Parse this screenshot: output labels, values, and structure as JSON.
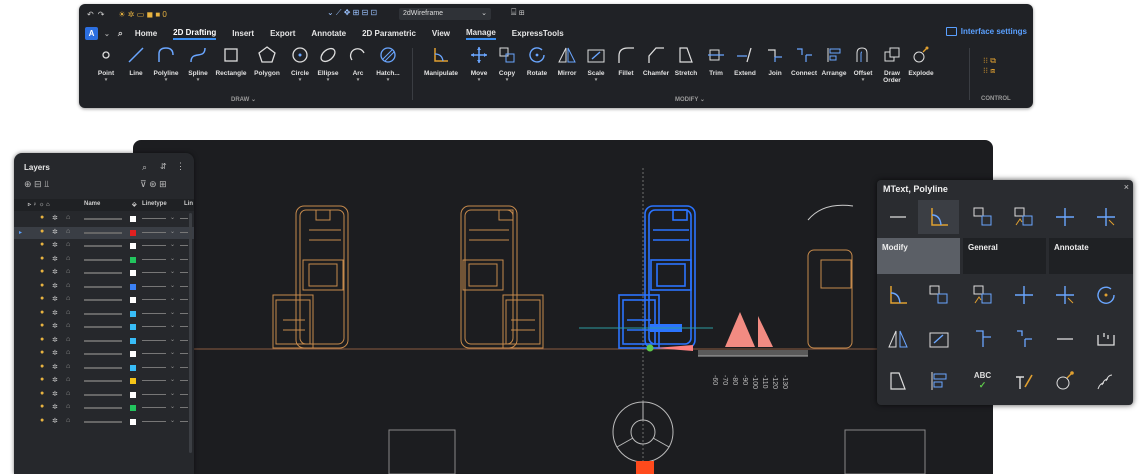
{
  "ribbon": {
    "visual_style": "2dWireframe",
    "interface_settings": "Interface settings",
    "menu_tabs": [
      "Home",
      "2D Drafting",
      "Insert",
      "Export",
      "Annotate",
      "2D Parametric",
      "View",
      "Manage",
      "ExpressTools"
    ],
    "active_tab": "2D Drafting",
    "draw_tools": [
      "Point",
      "Line",
      "Polyline",
      "Spline",
      "Rectangle",
      "Polygon",
      "Circle",
      "Ellipse",
      "Arc",
      "Hatch..."
    ],
    "modify_tools": [
      "Manipulate",
      "Move",
      "Copy",
      "Rotate",
      "Mirror",
      "Scale",
      "Fillet",
      "Chamfer",
      "Stretch",
      "Trim",
      "Extend",
      "Join",
      "Connect",
      "Arrange",
      "Offset",
      "Draw Order",
      "Explode"
    ],
    "groups": {
      "draw": "DRAW",
      "modify": "MODIFY",
      "control": "CONTROL"
    },
    "accent": "#3b8ef0"
  },
  "layers_panel": {
    "title": "Layers",
    "columns": {
      "name": "Name",
      "linetype": "Linetype",
      "lineweight": "Lin"
    },
    "swatches": [
      "#ffffff",
      "#e02020",
      "#ffffff",
      "#22c55e",
      "#ffffff",
      "#3b82f6",
      "#ffffff",
      "#38bdf8",
      "#38bdf8",
      "#38bdf8",
      "#ffffff",
      "#38bdf8",
      "#f5c518",
      "#ffffff",
      "#22c55e",
      "#ffffff"
    ]
  },
  "dim_labels": [
    "-60",
    "-70",
    "-80",
    "-90",
    "-100",
    "-110",
    "-120",
    "-130"
  ],
  "quad_panel": {
    "title": "MText, Polyline",
    "close": "×",
    "categories": [
      "Modify",
      "General",
      "Annotate"
    ],
    "active_category": "Modify",
    "text_icon": "ABC"
  },
  "colors": {
    "cad_orange": "#c68a4c",
    "cad_blue": "#2b74ff",
    "cad_bg": "#1c1d20"
  }
}
